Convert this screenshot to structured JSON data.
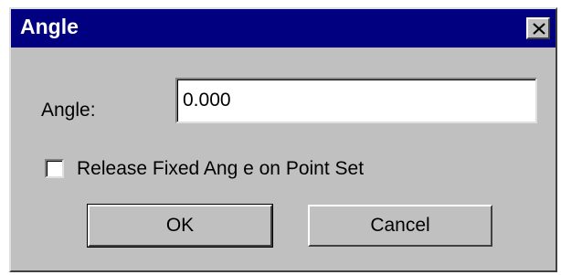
{
  "window": {
    "title": "Angle",
    "close_glyph": "×"
  },
  "form": {
    "angle_label": "Angle:",
    "angle_value": "0.000",
    "checkbox_label": "Release Fixed Ang e on Point Set",
    "checkbox_checked": false
  },
  "buttons": {
    "ok_label": "OK",
    "cancel_label": "Cancel"
  },
  "colors": {
    "titlebar": "#000080",
    "dialog_face": "#c0c0c0",
    "field_bg": "#ffffff"
  },
  "icons": {
    "close": "close-icon"
  }
}
